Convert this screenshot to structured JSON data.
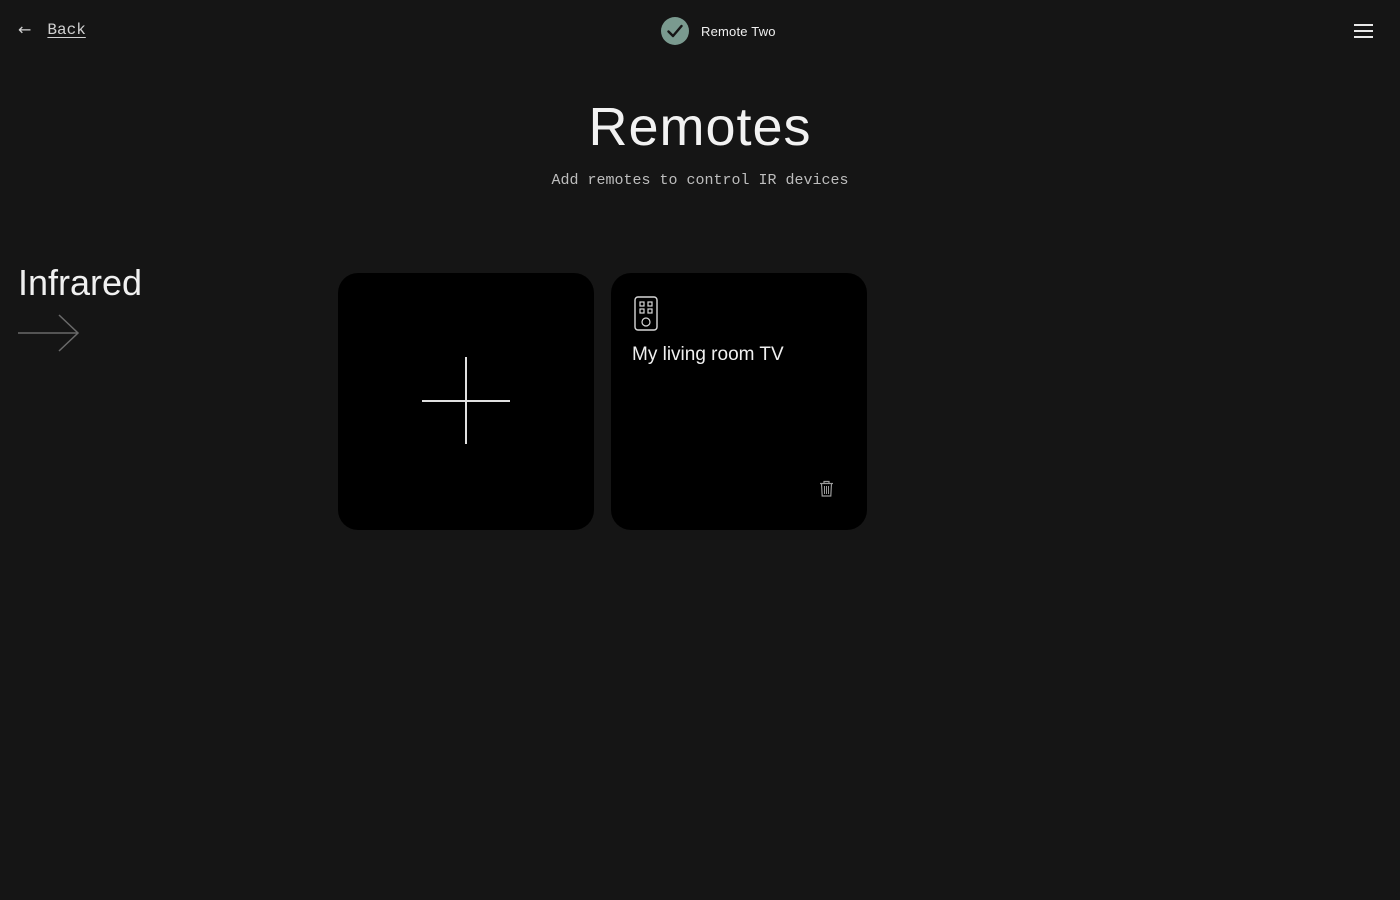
{
  "header": {
    "back_arrow": "←",
    "back_label": "Back",
    "device_name": "Remote Two",
    "device_status_icon": "check-icon",
    "status_color": "#7a9a8f",
    "menu_icon": "hamburger-menu-icon"
  },
  "page": {
    "title": "Remotes",
    "subtitle": "Add remotes to control IR devices"
  },
  "section": {
    "title": "Infrared",
    "arrow_icon": "long-arrow-right-icon"
  },
  "cards": {
    "add_icon": "plus-icon",
    "remotes": [
      {
        "name": "My living room TV",
        "icon": "remote-control-icon",
        "delete_icon": "trash-icon"
      }
    ]
  }
}
